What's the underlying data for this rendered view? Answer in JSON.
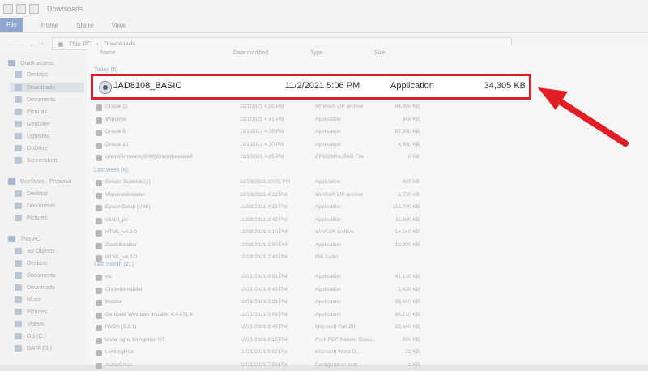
{
  "window": {
    "title": "Downloads"
  },
  "ribbon": {
    "tabs": [
      "File",
      "Home",
      "Share",
      "View"
    ]
  },
  "address": {
    "breadcrumb": [
      "This PC",
      "Downloads"
    ]
  },
  "sidebar": {
    "items": [
      {
        "label": "Quick access",
        "group": true
      },
      {
        "label": "Desktop"
      },
      {
        "label": "Downloads",
        "selected": true
      },
      {
        "label": "Documents"
      },
      {
        "label": "Pictures"
      },
      {
        "label": "GenDate"
      },
      {
        "label": "Lightshot"
      },
      {
        "label": "OnDrive"
      },
      {
        "label": "Screenshots"
      },
      {
        "label": "OneDrive - Personal",
        "group": true
      },
      {
        "label": "Desktop"
      },
      {
        "label": "Documents"
      },
      {
        "label": "Pictures"
      },
      {
        "label": "This PC",
        "group": true
      },
      {
        "label": "3D Objects"
      },
      {
        "label": "Desktop"
      },
      {
        "label": "Documents"
      },
      {
        "label": "Downloads"
      },
      {
        "label": "Music"
      },
      {
        "label": "Pictures"
      },
      {
        "label": "Videos"
      },
      {
        "label": "OS (C:)"
      },
      {
        "label": "DATA (D:)"
      }
    ]
  },
  "columns": [
    "Name",
    "Date modified",
    "Type",
    "Size"
  ],
  "sections": {
    "today": "Today (5)",
    "last_week": "Last week (6)",
    "last_month": "Last month (21)"
  },
  "highlighted_file": {
    "name": "JAD8108_BASIC",
    "date": "11/2/2021 5:06 PM",
    "type": "Application",
    "size": "34,305 KB"
  },
  "today_rows": [
    {
      "name": "Oracle 11",
      "date": "11/1/2021 4:55 PM",
      "type": "WinRAR ZIP archive",
      "size": "44,000 KB"
    },
    {
      "name": "Windows",
      "date": "11/1/2021 4:41 PM",
      "type": "Application",
      "size": "348 KB"
    },
    {
      "name": "Oracle 9",
      "date": "11/1/2021 4:35 PM",
      "type": "Application",
      "size": "87,350 KB"
    },
    {
      "name": "Oracle 10",
      "date": "11/1/2021 4:30 PM",
      "type": "Application",
      "size": "4,600 KB"
    },
    {
      "name": "UnionFirmware(2008)Crackdownload",
      "date": "11/1/2021 4:25 PM",
      "type": "CRDOWNLOAD File",
      "size": "0 KB"
    }
  ],
  "last_week_rows": [
    {
      "name": "IDAuto Sidekick (1)",
      "date": "10/28/2021 10:05 PM",
      "type": "Application",
      "size": "497 KB"
    },
    {
      "name": "WindowsInstaller",
      "date": "10/28/2021 4:12 PM",
      "type": "WinRAR ZIP archive",
      "size": "2,750 KB"
    },
    {
      "name": "Epson Setup (VB6)",
      "date": "10/28/2021 4:12 PM",
      "type": "Application",
      "size": "112,700 KB"
    },
    {
      "name": "win10_pe",
      "date": "10/28/2021 3:45 PM",
      "type": "Application",
      "size": "11,600 KB"
    },
    {
      "name": "HTML_v4.3.0",
      "date": "10/28/2021 3:10 PM",
      "type": "WinRAR archive",
      "size": "14,540 KB"
    },
    {
      "name": "Zoominstaller",
      "date": "10/28/2021 2:50 PM",
      "type": "Application",
      "size": "19,200 KB"
    },
    {
      "name": "HTML_v4.3.0",
      "date": "10/28/2021 2:40 PM",
      "type": "File folder",
      "size": ""
    }
  ],
  "last_month_rows": [
    {
      "name": "vlc",
      "date": "10/21/2021 9:51 PM",
      "type": "Application",
      "size": "41,130 KB"
    },
    {
      "name": "ChromeInstaller",
      "date": "10/21/2021 9:40 PM",
      "type": "Application",
      "size": "1,430 KB"
    },
    {
      "name": "Mozilla",
      "date": "10/21/2021 9:21 PM",
      "type": "Application",
      "size": "38,640 KB"
    },
    {
      "name": "GenDate Windows Installer 4.4.471.4",
      "date": "10/21/2021 9:05 PM",
      "type": "Application",
      "size": "96,210 KB"
    },
    {
      "name": "NVDA (3.2.1)",
      "date": "10/21/2021 8:40 PM",
      "type": "Microsoft Pub ZIP",
      "size": "22,640 KB"
    },
    {
      "name": "khoai ngoc toi ngotian HT",
      "date": "10/21/2021 8:15 PM",
      "type": "Foxit PDF Reader Docu...",
      "size": "890 KB"
    },
    {
      "name": "LeHongHoa",
      "date": "10/21/2021 8:02 PM",
      "type": "Microsoft Word D...",
      "size": "22 KB"
    },
    {
      "name": "AudioCrisis",
      "date": "10/21/2021 7:50 PM",
      "type": "Configuration setti...",
      "size": "1 KB"
    }
  ],
  "colors": {
    "highlight_border": "#e31d25",
    "arrow": "#e31d25"
  }
}
